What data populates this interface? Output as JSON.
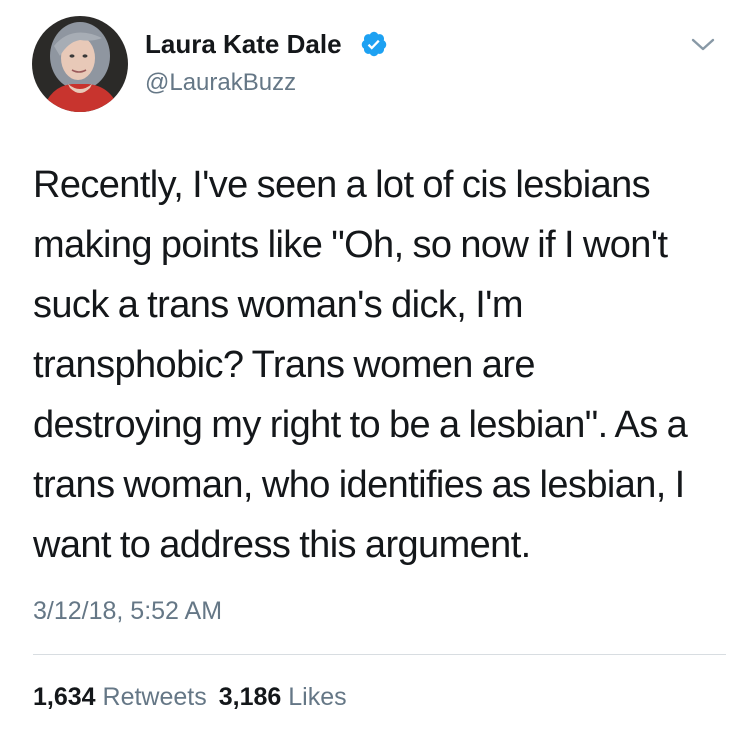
{
  "author": {
    "display_name": "Laura Kate Dale",
    "handle": "@LaurakBuzz",
    "verified": true,
    "verified_icon": "verified-badge-icon",
    "verified_color": "#1da1f2",
    "avatar_icon": "profile-photo"
  },
  "menu": {
    "icon": "chevron-down-icon"
  },
  "tweet": {
    "lines": [
      "Recently, I've seen a lot of cis lesbians",
      "making points like \"Oh, so now if I won't",
      "suck a trans woman's dick, I'm",
      "transphobic? Trans women are",
      "destroying my right to be a lesbian\". As a",
      "trans woman, who identifies as lesbian, I",
      "want to address this argument."
    ],
    "timestamp": "3/12/18, 5:52 AM"
  },
  "stats": {
    "retweets_count": "1,634",
    "retweets_label": "Retweets",
    "likes_count": "3,186",
    "likes_label": "Likes"
  },
  "colors": {
    "text_primary": "#14171a",
    "text_secondary": "#657786",
    "divider": "#d8dde1"
  }
}
